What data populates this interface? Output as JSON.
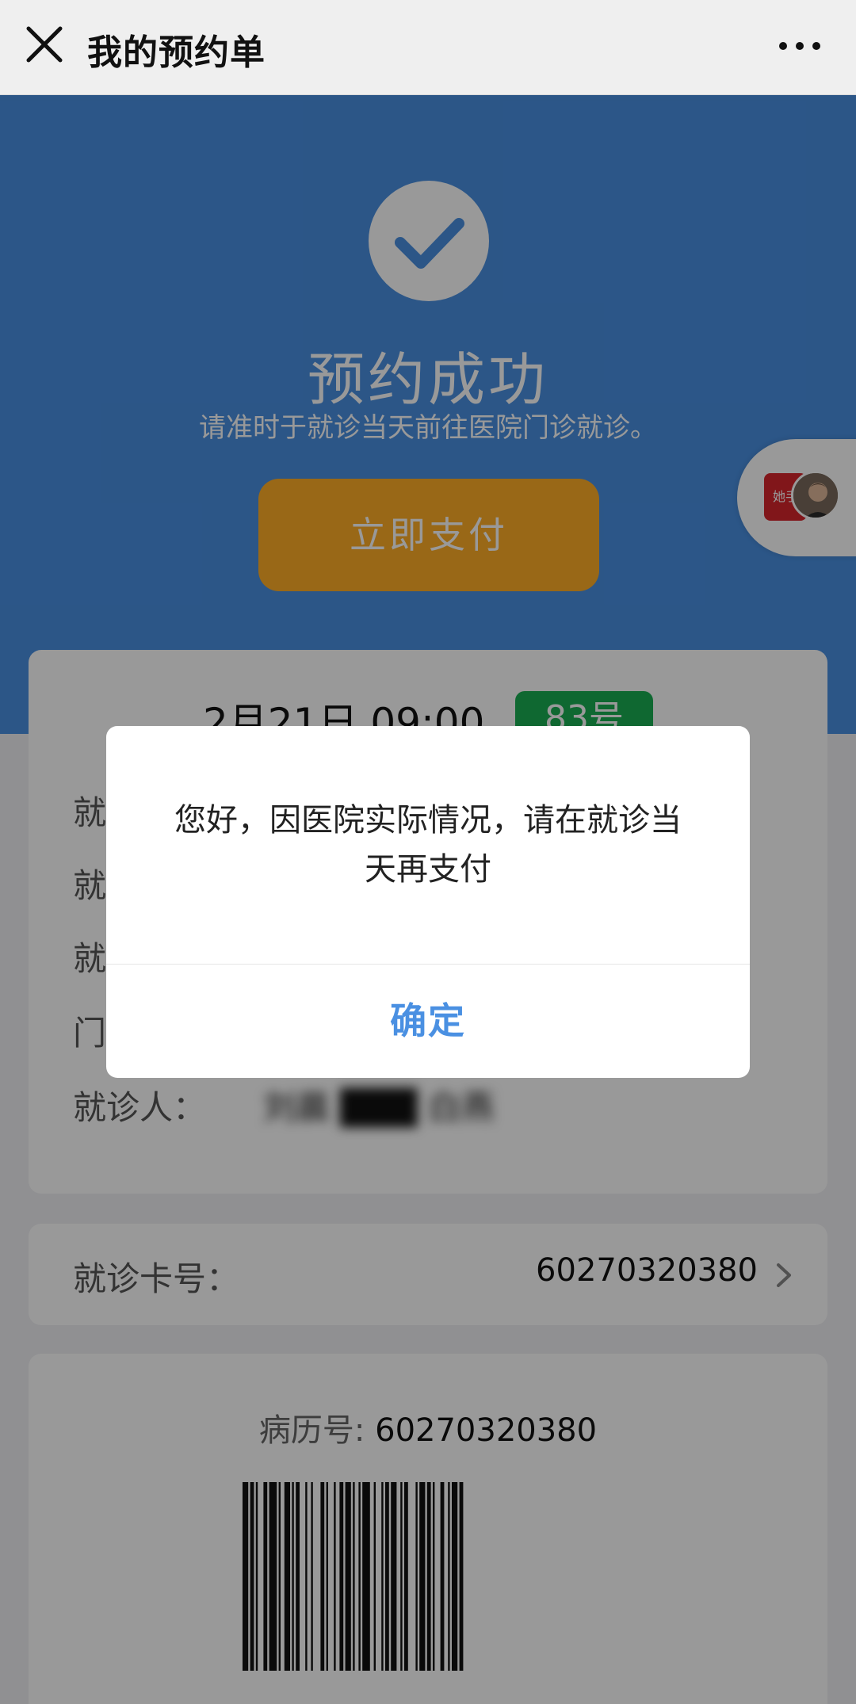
{
  "navbar": {
    "title": "我的预约单"
  },
  "hero": {
    "title": "预约成功",
    "subtitle": "请准时于就诊当天前往医院门诊就诊。",
    "pay_button": "立即支付"
  },
  "bubble": {
    "book_text": "她手 lithe"
  },
  "appointment": {
    "time": "2月21日 09:00",
    "number": "83号",
    "rows": [
      {
        "label": "就",
        "value": ""
      },
      {
        "label": "就",
        "value": ""
      },
      {
        "label": "就",
        "value": ""
      },
      {
        "label": "门",
        "value": ""
      },
      {
        "label": "就诊人：",
        "value": "刘晨 ███ 白燕"
      }
    ]
  },
  "card": {
    "label": "就诊卡号：",
    "value": "60270320380"
  },
  "record": {
    "label": "病历号: ",
    "value": "60270320380"
  },
  "dialog": {
    "message": "您好，因医院实际情况，请在就诊当天再支付",
    "confirm": "确定"
  },
  "colors": {
    "brand_blue": "#4a90e2",
    "pay_orange": "#ffae27",
    "badge_green": "#1aad52"
  }
}
